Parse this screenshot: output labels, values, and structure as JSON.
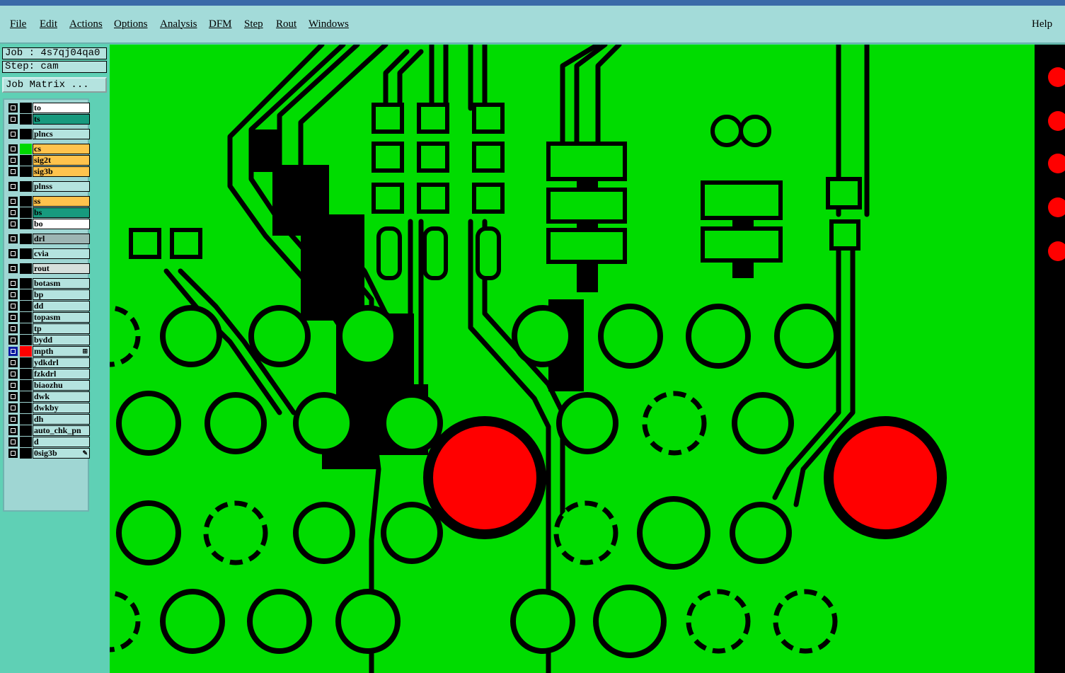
{
  "menu": {
    "items": [
      "File",
      "Edit",
      "Actions",
      "Options",
      "Analysis",
      "DFM",
      "Step",
      "Rout",
      "Windows"
    ],
    "help": "Help"
  },
  "job": {
    "label": "Job : 4s7qj04qa0",
    "step": "Step: cam",
    "matrix_button": "Job Matrix ..."
  },
  "layers": [
    {
      "name": "to",
      "bg": "#ffffff",
      "color": "#000000"
    },
    {
      "name": "ts",
      "bg": "#179a7e",
      "color": "#000000"
    },
    {
      "name": "plncs",
      "bg": "#b4e3df",
      "color": "#000000"
    },
    {
      "name": "cs",
      "bg": "#ffc34d",
      "color": "#00d800"
    },
    {
      "name": "sig2t",
      "bg": "#ffc34d",
      "color": "#000000"
    },
    {
      "name": "sig3b",
      "bg": "#ffc34d",
      "color": "#000000"
    },
    {
      "name": "plnss",
      "bg": "#b4e3df",
      "color": "#000000"
    },
    {
      "name": "ss",
      "bg": "#ffc34d",
      "color": "#000000"
    },
    {
      "name": "bs",
      "bg": "#179a7e",
      "color": "#000000"
    },
    {
      "name": "bo",
      "bg": "#ffffff",
      "color": "#000000"
    },
    {
      "name": "drl",
      "bg": "#9db5b3",
      "color": "#000000"
    },
    {
      "name": "cvia",
      "bg": "#b4e3df",
      "color": "#000000"
    },
    {
      "name": "rout",
      "bg": "#d6e0dc",
      "color": "#000000"
    },
    {
      "name": "botasm",
      "bg": "#b4e3df",
      "color": "#000000"
    },
    {
      "name": "bp",
      "bg": "#b4e3df",
      "color": "#000000"
    },
    {
      "name": "dd",
      "bg": "#b4e3df",
      "color": "#000000"
    },
    {
      "name": "topasm",
      "bg": "#b4e3df",
      "color": "#000000"
    },
    {
      "name": "tp",
      "bg": "#b4e3df",
      "color": "#000000"
    },
    {
      "name": "bydd",
      "bg": "#b4e3df",
      "color": "#000000"
    },
    {
      "name": "mpth",
      "bg": "#b4e3df",
      "color": "#ff0000",
      "active": true,
      "mark": "⊞"
    },
    {
      "name": "ydkdrl",
      "bg": "#b4e3df",
      "color": "#000000"
    },
    {
      "name": "fzkdrl",
      "bg": "#b4e3df",
      "color": "#000000"
    },
    {
      "name": "biaozhu",
      "bg": "#b4e3df",
      "color": "#000000"
    },
    {
      "name": "dwk",
      "bg": "#b4e3df",
      "color": "#000000"
    },
    {
      "name": "dwkby",
      "bg": "#b4e3df",
      "color": "#000000"
    },
    {
      "name": "dh",
      "bg": "#b4e3df",
      "color": "#000000"
    },
    {
      "name": "auto_chk_pn",
      "bg": "#b4e3df",
      "color": "#000000"
    },
    {
      "name": "d",
      "bg": "#b4e3df",
      "color": "#000000"
    },
    {
      "name": "0sig3b",
      "bg": "#b4e3df",
      "color": "#000000",
      "mark": "✎"
    }
  ],
  "colors": {
    "board": "#00dc00",
    "copper_clear": "#000000",
    "drill": "#ff0000"
  }
}
